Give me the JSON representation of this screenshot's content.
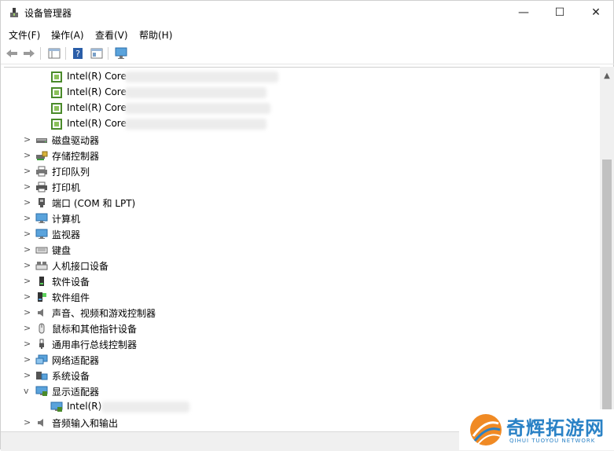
{
  "window": {
    "title": "设备管理器"
  },
  "window_controls": {
    "minimize": "—",
    "maximize": "☐",
    "close": "✕"
  },
  "menu": [
    {
      "label": "文件(F)"
    },
    {
      "label": "操作(A)"
    },
    {
      "label": "查看(V)"
    },
    {
      "label": "帮助(H)"
    }
  ],
  "tree": {
    "processors": [
      {
        "label": "Intel(R) Core"
      },
      {
        "label": "Intel(R) Core"
      },
      {
        "label": "Intel(R) Core"
      },
      {
        "label": "Intel(R) Core"
      }
    ],
    "categories": [
      {
        "label": "磁盘驱动器",
        "icon": "disk-icon",
        "expanded": false
      },
      {
        "label": "存储控制器",
        "icon": "storage-controller-icon",
        "expanded": false
      },
      {
        "label": "打印队列",
        "icon": "print-queue-icon",
        "expanded": false
      },
      {
        "label": "打印机",
        "icon": "printer-icon",
        "expanded": false
      },
      {
        "label": "端口 (COM 和 LPT)",
        "icon": "port-icon",
        "expanded": false
      },
      {
        "label": "计算机",
        "icon": "computer-icon",
        "expanded": false
      },
      {
        "label": "监视器",
        "icon": "monitor-icon",
        "expanded": false
      },
      {
        "label": "键盘",
        "icon": "keyboard-icon",
        "expanded": false
      },
      {
        "label": "人机接口设备",
        "icon": "hid-icon",
        "expanded": false
      },
      {
        "label": "软件设备",
        "icon": "software-device-icon",
        "expanded": false
      },
      {
        "label": "软件组件",
        "icon": "software-component-icon",
        "expanded": false
      },
      {
        "label": "声音、视频和游戏控制器",
        "icon": "speaker-icon",
        "expanded": false
      },
      {
        "label": "鼠标和其他指针设备",
        "icon": "mouse-icon",
        "expanded": false
      },
      {
        "label": "通用串行总线控制器",
        "icon": "usb-icon",
        "expanded": false
      },
      {
        "label": "网络适配器",
        "icon": "network-icon",
        "expanded": false
      },
      {
        "label": "系统设备",
        "icon": "system-device-icon",
        "expanded": false
      },
      {
        "label": "显示适配器",
        "icon": "display-adapter-icon",
        "expanded": true
      },
      {
        "label": "音频输入和输出",
        "icon": "audio-io-icon",
        "expanded": false
      }
    ],
    "display_child": {
      "label": "Intel(R)"
    }
  },
  "watermark": {
    "text": "奇辉拓游网",
    "sub": "QIHUI TUOYOU NETWORK"
  },
  "colors": {
    "accent": "#2a82c6",
    "chip_green": "#4a8a2a"
  }
}
